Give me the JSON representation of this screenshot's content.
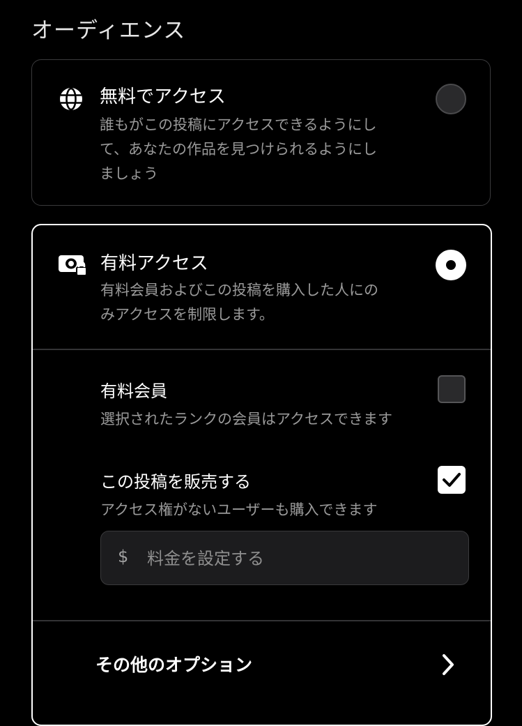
{
  "section": {
    "title": "オーディエンス"
  },
  "free_access": {
    "icon": "globe-icon",
    "title": "無料でアクセス",
    "description_lines": [
      "誰もがこの投稿にアクセスできるようにし",
      "て、あなたの作品を見つけられるようにし",
      "ましょう"
    ],
    "selected": false
  },
  "paid_access": {
    "icon": "money-lock-icon",
    "title": "有料アクセス",
    "description_lines": [
      "有料会員およびこの投稿を購入した人にの",
      "みアクセスを制限します。"
    ],
    "selected": true,
    "members": {
      "title": "有料会員",
      "description": "選択されたランクの会員はアクセスできます",
      "checked": false
    },
    "sell": {
      "title": "この投稿を販売する",
      "description": "アクセス権がないユーザーも購入できます",
      "checked": true
    },
    "price": {
      "currency_symbol": "$",
      "placeholder": "料金を設定する",
      "value": ""
    }
  },
  "more_options": {
    "label": "その他のオプション",
    "icon": "chevron-right-icon"
  },
  "colors": {
    "background": "#000000",
    "text_primary": "#ffffff",
    "text_secondary": "#9a9a9a",
    "border_selected": "#ffffff",
    "border_default": "#3a3a3c"
  }
}
